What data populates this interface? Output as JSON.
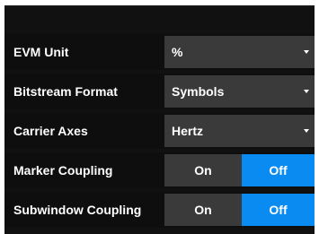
{
  "settings": {
    "evm_unit": {
      "label": "EVM Unit",
      "value": "%"
    },
    "bitstream_format": {
      "label": "Bitstream Format",
      "value": "Symbols"
    },
    "carrier_axes": {
      "label": "Carrier Axes",
      "value": "Hertz"
    },
    "marker_coupling": {
      "label": "Marker Coupling",
      "on_label": "On",
      "off_label": "Off",
      "selected": "Off"
    },
    "subwindow_coupling": {
      "label": "Subwindow Coupling",
      "on_label": "On",
      "off_label": "Off",
      "selected": "Off"
    }
  },
  "colors": {
    "panel_bg": "#111111",
    "control_bg": "#3a3a3a",
    "selected_accent": "#0a8bf2",
    "text": "#ffffff"
  },
  "icons": {
    "dropdown": "chevron-down-icon"
  }
}
